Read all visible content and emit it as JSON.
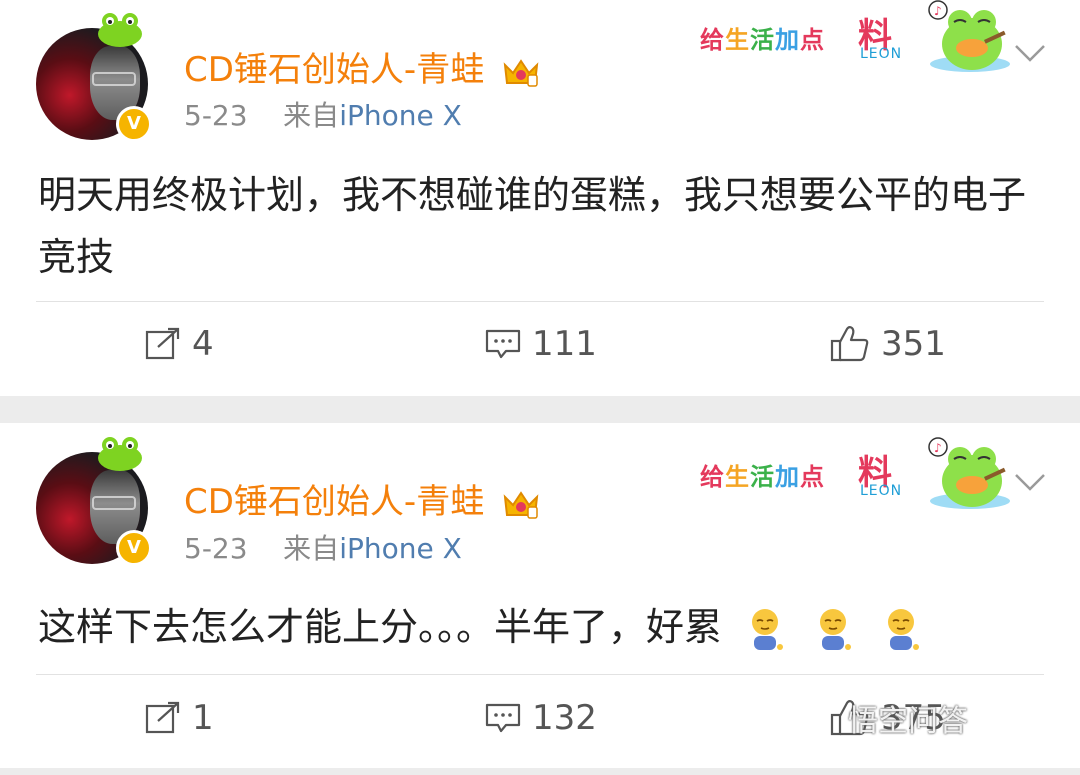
{
  "posts": [
    {
      "author": "CD锤石创始人-青蛙",
      "time": "5-23",
      "source_prefix": "来自",
      "source": "iPhone X",
      "text": "明天用终极计划，我不想碰谁的蛋糕，我只想要公平的电子竞技",
      "card_decoration": {
        "slogan_chars": [
          "给",
          "生",
          "活",
          "加",
          "点"
        ],
        "slogan_big": "料",
        "brand": "LEON"
      },
      "actions": {
        "repost_count": "4",
        "comment_count": "111",
        "like_count": "351"
      }
    },
    {
      "author": "CD锤石创始人-青蛙",
      "time": "5-23",
      "source_prefix": "来自",
      "source": "iPhone X",
      "text": "这样下去怎么才能上分。。。半年了，好累",
      "card_decoration": {
        "slogan_chars": [
          "给",
          "生",
          "活",
          "加",
          "点"
        ],
        "slogan_big": "料",
        "brand": "LEON"
      },
      "actions": {
        "repost_count": "1",
        "comment_count": "132",
        "like_count": "375"
      }
    }
  ],
  "icons": {
    "repost": "repost-icon",
    "comment": "comment-icon",
    "like": "thumbs-up-icon",
    "more": "chevron-down-icon",
    "verified": "verified-badge-icon",
    "member": "crown-icon"
  },
  "colors": {
    "author_name": "#f4800b",
    "source_link": "#507daf",
    "meta_text": "#8a8a8a",
    "body_text": "#222222",
    "feed_background": "#ececec",
    "verified_badge": "#f6b400"
  },
  "watermark": "悟空问答"
}
